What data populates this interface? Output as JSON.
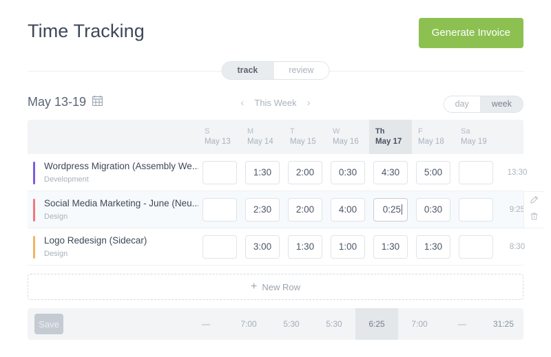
{
  "header": {
    "title": "Time Tracking",
    "invoice_button": "Generate Invoice"
  },
  "tabs": [
    {
      "label": "track",
      "active": true
    },
    {
      "label": "review",
      "active": false
    }
  ],
  "datebar": {
    "range": "May 13-19",
    "calendar_icon": "calendar-icon",
    "prev_arrow": "‹",
    "next_arrow": "›",
    "week_label": "This Week",
    "view_options": [
      {
        "label": "day",
        "active": false
      },
      {
        "label": "week",
        "active": true
      }
    ]
  },
  "columns": [
    {
      "dow": "S",
      "date": "May 13",
      "today": false
    },
    {
      "dow": "M",
      "date": "May 14",
      "today": false
    },
    {
      "dow": "T",
      "date": "May 15",
      "today": false
    },
    {
      "dow": "W",
      "date": "May 16",
      "today": false
    },
    {
      "dow": "Th",
      "date": "May 17",
      "today": true
    },
    {
      "dow": "F",
      "date": "May 18",
      "today": false
    },
    {
      "dow": "Sa",
      "date": "May 19",
      "today": false
    }
  ],
  "rows": [
    {
      "name": "Wordpress Migration (Assembly We...",
      "category": "Development",
      "color": "#7c5ce0",
      "entries": [
        "",
        "1:30",
        "2:00",
        "0:30",
        "4:30",
        "5:00",
        ""
      ],
      "total": "13:30",
      "active": false,
      "focused_index": -1
    },
    {
      "name": "Social Media Marketing - June (Neu...)",
      "category": "Design",
      "color": "#f2767f",
      "entries": [
        "",
        "2:30",
        "2:00",
        "4:00",
        "0:25",
        "0:30",
        ""
      ],
      "total": "9:25",
      "active": true,
      "focused_index": 4
    },
    {
      "name": "Logo Redesign (Sidecar)",
      "category": "Design",
      "color": "#f0b464",
      "entries": [
        "",
        "3:00",
        "1:30",
        "1:00",
        "1:30",
        "1:30",
        ""
      ],
      "total": "8:30",
      "active": false,
      "focused_index": -1
    }
  ],
  "new_row": {
    "label": "New Row",
    "plus": "+"
  },
  "footer": {
    "save_label": "Save",
    "day_totals": [
      "—",
      "7:00",
      "5:30",
      "5:30",
      "6:25",
      "7:00",
      "—"
    ],
    "grand_total": "31:25"
  },
  "row_actions": {
    "edit_icon": "pencil-icon",
    "delete_icon": "trash-icon"
  },
  "colors": {
    "accent_green": "#8cc152",
    "today_highlight": "#e4e7ea",
    "header_bg": "#f2f4f6"
  }
}
